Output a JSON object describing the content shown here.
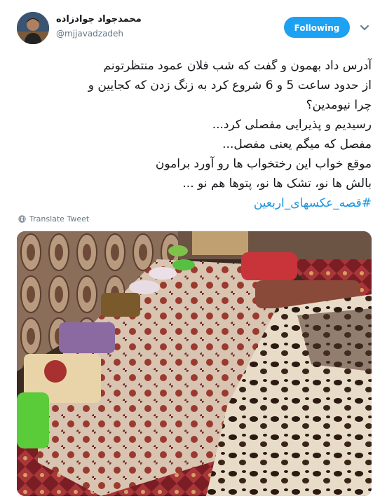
{
  "user": {
    "display_name": "محمدجواد جوادزاده",
    "handle": "@mjjavadzadeh"
  },
  "follow_button": {
    "label": "Following"
  },
  "more_icon": "chevron-down-icon",
  "tweet": {
    "lines": [
      "آدرس داد بهمون و گفت که شب فلان عمود منتظرتونم",
      "از حدود ساعت 5 و 6 شروع کرد به زنگ زدن که کجایین و",
      "چرا نیومدین؟",
      "رسیدیم و پذیرایی مفصلی کرد...",
      "مفصل که میگم یعنی مفصل...",
      "موقع خواب این رختخواب ها رو آورد برامون",
      "بالش ها نو، تشک ها نو، پتوها هم نو ..."
    ],
    "hashtag": "#قصه_عکسهای_اربعین"
  },
  "translate": {
    "label": "Translate Tweet",
    "icon": "globe-icon"
  },
  "colors": {
    "accent": "#1da1f2",
    "hashtag": "#1b95e0",
    "muted": "#657786",
    "text": "#14171a"
  }
}
